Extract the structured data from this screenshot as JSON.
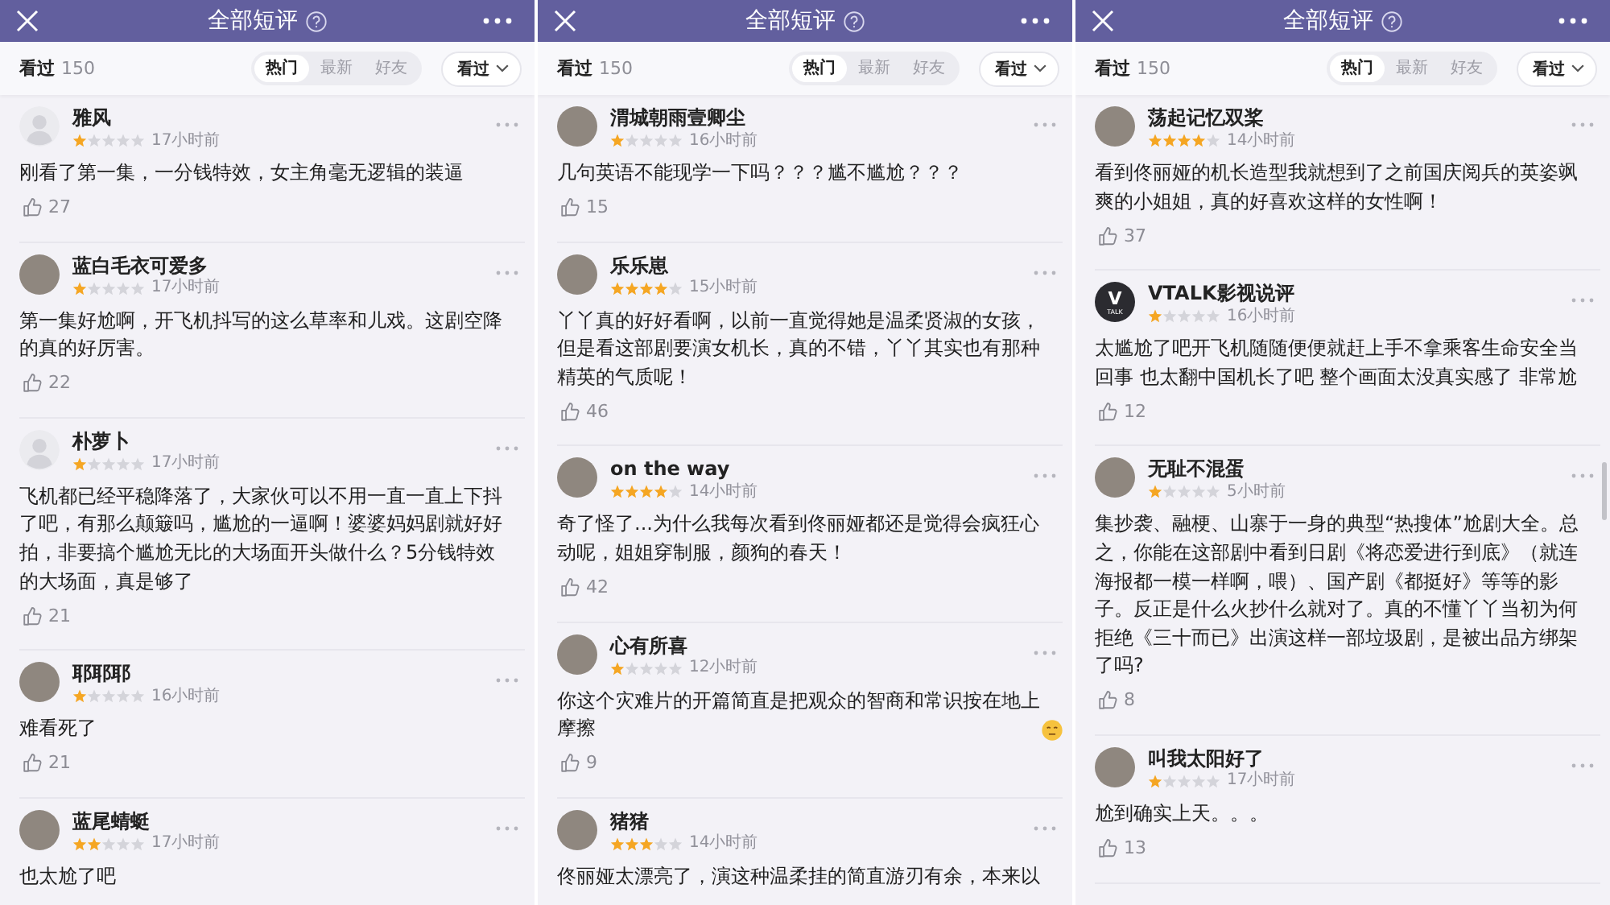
{
  "panels": [
    {
      "header": {
        "title": "全部短评"
      },
      "filter": {
        "label": "看过",
        "count": "150",
        "tabs": [
          {
            "label": "热门",
            "selected": true
          },
          {
            "label": "最新",
            "selected": false
          },
          {
            "label": "好友",
            "selected": false
          }
        ],
        "dropdown": "看过"
      },
      "scrollbar": false,
      "comments": [
        {
          "avatar": {
            "kind": "default"
          },
          "name": "雅风",
          "stars": 1,
          "time": "17小时前",
          "text": "刚看了第一集，一分钱特效，女主角毫无逻辑的装逼",
          "likes": "27"
        },
        {
          "avatar": {
            "kind": "photo"
          },
          "name": "蓝白毛衣可爱多",
          "stars": 1,
          "time": "17小时前",
          "text": "第一集好尬啊，开飞机抖写的这么草率和儿戏。这剧空降的真的好厉害。",
          "likes": "22"
        },
        {
          "avatar": {
            "kind": "default"
          },
          "name": "朴萝卜",
          "stars": 1,
          "time": "17小时前",
          "text": "飞机都已经平稳降落了，大家伙可以不用一直一直上下抖了吧，有那么颠簸吗，尴尬的一逼啊！婆婆妈妈剧就好好拍，非要搞个尴尬无比的大场面开头做什么？5分钱特效的大场面，真是够了",
          "likes": "21"
        },
        {
          "avatar": {
            "kind": "photo"
          },
          "name": "耶耶耶",
          "stars": 1,
          "time": "16小时前",
          "text": "难看死了",
          "likes": "21"
        },
        {
          "avatar": {
            "kind": "photo"
          },
          "name": "蓝尾蜻蜓",
          "stars": 2,
          "time": "17小时前",
          "text": "也太尬了吧"
        }
      ]
    },
    {
      "header": {
        "title": "全部短评"
      },
      "filter": {
        "label": "看过",
        "count": "150",
        "tabs": [
          {
            "label": "热门",
            "selected": true
          },
          {
            "label": "最新",
            "selected": false
          },
          {
            "label": "好友",
            "selected": false
          }
        ],
        "dropdown": "看过"
      },
      "scrollbar": false,
      "comments": [
        {
          "avatar": {
            "kind": "photo"
          },
          "name": "渭城朝雨壹卿尘",
          "stars": 1,
          "time": "16小时前",
          "text": "几句英语不能现学一下吗？？？尴不尴尬？？？",
          "likes": "15"
        },
        {
          "avatar": {
            "kind": "photo"
          },
          "name": "乐乐崽",
          "stars": 4,
          "time": "15小时前",
          "text": "丫丫真的好好看啊，以前一直觉得她是温柔贤淑的女孩，但是看这部剧要演女机长，真的不错，丫丫其实也有那种精英的气质呢！",
          "likes": "46"
        },
        {
          "avatar": {
            "kind": "photo"
          },
          "name": "on the way",
          "stars": 4,
          "time": "14小时前",
          "text": "奇了怪了...为什么我每次看到佟丽娅都还是觉得会疯狂心动呢，姐姐穿制服，颜狗的春天！",
          "likes": "42"
        },
        {
          "avatar": {
            "kind": "photo"
          },
          "name": "心有所喜",
          "stars": 1,
          "time": "12小时前",
          "text": "你这个灾难片的开篇简直是把观众的智商和常识按在地上摩擦",
          "trailing_emoji": true,
          "likes": "9"
        },
        {
          "avatar": {
            "kind": "photo"
          },
          "name": "猪猪",
          "stars": 3,
          "time": "14小时前",
          "text": "佟丽娅太漂亮了，演这种温柔挂的简直游刃有余，本来以"
        }
      ]
    },
    {
      "header": {
        "title": "全部短评"
      },
      "filter": {
        "label": "看过",
        "count": "150",
        "tabs": [
          {
            "label": "热门",
            "selected": true
          },
          {
            "label": "最新",
            "selected": false
          },
          {
            "label": "好友",
            "selected": false
          }
        ],
        "dropdown": "看过"
      },
      "scrollbar": true,
      "comments": [
        {
          "avatar": {
            "kind": "photo"
          },
          "name": "荡起记忆双桨",
          "stars": 4,
          "time": "14小时前",
          "text": "看到佟丽娅的机长造型我就想到了之前国庆阅兵的英姿飒爽的小姐姐，真的好喜欢这样的女性啊！",
          "likes": "37"
        },
        {
          "avatar": {
            "kind": "logo",
            "mark": "V",
            "caption": "TALK"
          },
          "name": "VTALK影视说评",
          "stars": 1,
          "time": "16小时前",
          "text": "太尴尬了吧开飞机随随便便就赶上手不拿乘客生命安全当回事 也太翻中国机长了吧 整个画面太没真实感了 非常尬",
          "likes": "12"
        },
        {
          "avatar": {
            "kind": "photo"
          },
          "name": "无耻不混蛋",
          "stars": 1,
          "time": "5小时前",
          "text": "集抄袭、融梗、山寨于一身的典型“热搜体”尬剧大全。总之，你能在这部剧中看到日剧《将恋爱进行到底》（就连海报都一模一样啊，喂）、国产剧《都挺好》等等的影子。反正是什么火抄什么就对了。真的不懂丫丫当初为何拒绝《三十而已》出演这样一部垃圾剧，是被出品方绑架了吗?",
          "likes": "8"
        },
        {
          "avatar": {
            "kind": "photo"
          },
          "name": "叫我太阳好了",
          "stars": 1,
          "time": "17小时前",
          "text": "尬到确实上天。。。",
          "likes": "13"
        }
      ]
    }
  ]
}
